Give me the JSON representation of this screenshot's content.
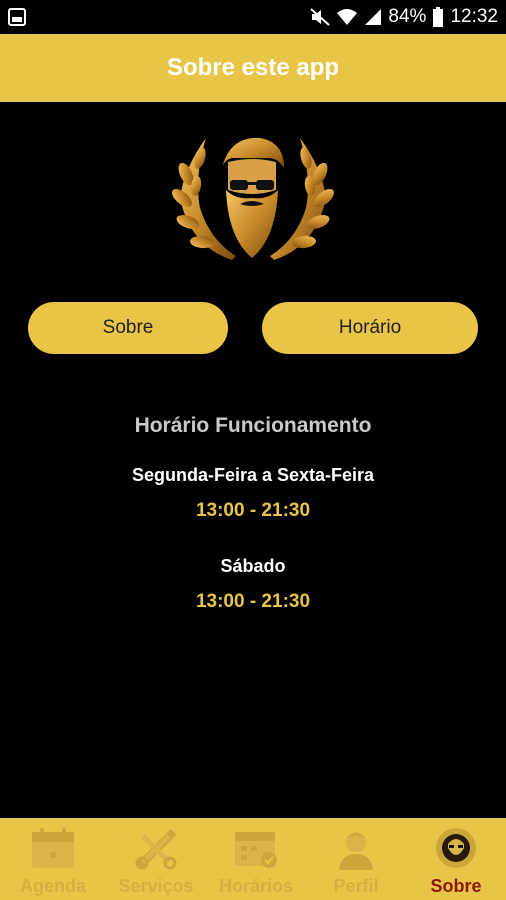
{
  "status_bar": {
    "battery": "84%",
    "time": "12:32",
    "icons": [
      "screenshot-icon",
      "mute-icon",
      "wifi-icon",
      "signal-icon",
      "battery-icon"
    ]
  },
  "app_bar": {
    "title": "Sobre este app"
  },
  "logo": {
    "icon": "bearded-man-laurel-logo"
  },
  "tabs": [
    {
      "label": "Sobre"
    },
    {
      "label": "Horário"
    }
  ],
  "schedule": {
    "title": "Horário Funcionamento",
    "entries": [
      {
        "day": "Segunda-Feira a Sexta-Feira",
        "hours": "13:00 - 21:30"
      },
      {
        "day": "Sábado",
        "hours": "13:00 - 21:30"
      }
    ]
  },
  "bottom_nav": {
    "items": [
      {
        "label": "Agenda",
        "icon": "calendar-icon"
      },
      {
        "label": "Serviços",
        "icon": "scissors-comb-icon"
      },
      {
        "label": "Horários",
        "icon": "schedule-icon"
      },
      {
        "label": "Perfil",
        "icon": "profile-icon"
      },
      {
        "label": "Sobre",
        "icon": "logo-icon"
      }
    ],
    "active": "Sobre"
  },
  "colors": {
    "accent": "#e8c547",
    "background": "#000000",
    "active_nav": "#8b1a14"
  }
}
